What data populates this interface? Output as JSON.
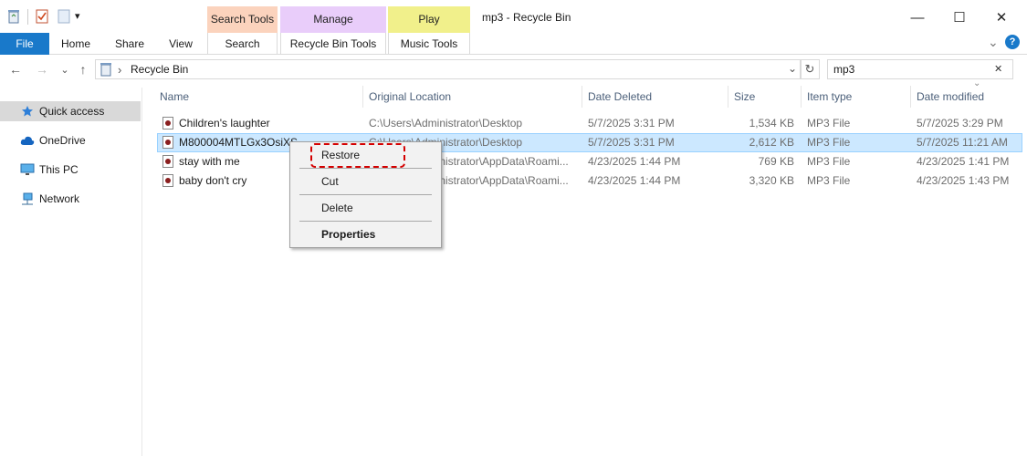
{
  "window": {
    "title": "mp3 - Recycle Bin",
    "minimize": "—",
    "maximize": "☐",
    "close": "✕"
  },
  "quick_access_toolbar": {
    "dropdown": "▾"
  },
  "ribbon": {
    "file_tab": "File",
    "tabs": [
      "Home",
      "Share",
      "View"
    ],
    "contextual": [
      {
        "group": "Search Tools",
        "tab": "Search",
        "color": "#fbd3bd"
      },
      {
        "group": "Manage",
        "tab": "Recycle Bin Tools",
        "color": "#e9cdfa"
      },
      {
        "group": "Play",
        "tab": "Music Tools",
        "color": "#f1f08b"
      }
    ],
    "collapse": "⌄",
    "help": "?"
  },
  "address": {
    "back": "←",
    "forward": "→",
    "recent": "⌄",
    "up": "↑",
    "separator": "›",
    "path": "Recycle Bin",
    "dropdown": "⌄",
    "refresh": "↻",
    "search_value": "mp3",
    "search_clear": "✕"
  },
  "nav_pane": {
    "items": [
      {
        "label": "Quick access",
        "icon": "star-icon"
      },
      {
        "label": "OneDrive",
        "icon": "cloud-icon"
      },
      {
        "label": "This PC",
        "icon": "monitor-icon"
      },
      {
        "label": "Network",
        "icon": "network-icon"
      }
    ]
  },
  "columns": [
    "Name",
    "Original Location",
    "Date Deleted",
    "Size",
    "Item type",
    "Date modified"
  ],
  "sort_indicator": "⌄",
  "files": [
    {
      "name": "Children's laughter",
      "location": "C:\\Users\\Administrator\\Desktop",
      "deleted": "5/7/2025 3:31 PM",
      "size": "1,534 KB",
      "type": "MP3 File",
      "modified": "5/7/2025 3:29 PM"
    },
    {
      "name": "M800004MTLGx3OsiXS",
      "location": "C:\\Users\\Administrator\\Desktop",
      "deleted": "5/7/2025 3:31 PM",
      "size": "2,612 KB",
      "type": "MP3 File",
      "modified": "5/7/2025 11:21 AM"
    },
    {
      "name": "stay with me",
      "location": "C:\\Users\\Administrator\\AppData\\Roami...",
      "deleted": "4/23/2025 1:44 PM",
      "size": "769 KB",
      "type": "MP3 File",
      "modified": "4/23/2025 1:41 PM"
    },
    {
      "name": "baby don't cry",
      "location": "C:\\Users\\Administrator\\AppData\\Roami...",
      "deleted": "4/23/2025 1:44 PM",
      "size": "3,320 KB",
      "type": "MP3 File",
      "modified": "4/23/2025 1:43 PM"
    }
  ],
  "context_menu": {
    "restore": "Restore",
    "cut": "Cut",
    "delete": "Delete",
    "properties": "Properties",
    "highlight_color": "#d40000"
  },
  "colors": {
    "accent": "#1979ca",
    "selection": "#cce8ff"
  }
}
